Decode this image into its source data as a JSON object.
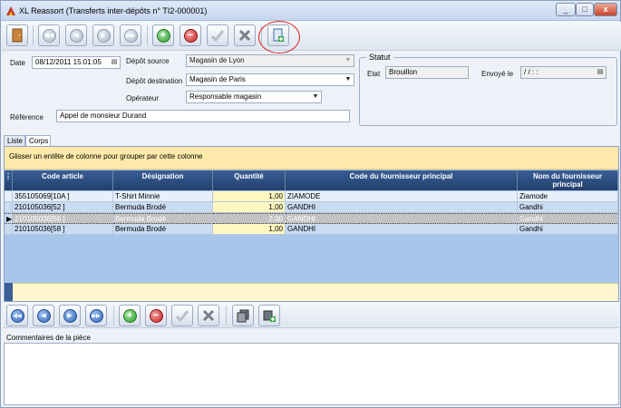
{
  "window": {
    "title": "XL Reassort (Transferts inter-dépôts n° TI2-000001)",
    "controls": {
      "minimize": "_",
      "maximize": "□",
      "close": "x"
    }
  },
  "toolbar": {
    "buttons": [
      {
        "name": "close-document-button",
        "icon": "door-exit-icon"
      },
      {
        "name": "first-record-button",
        "icon": "double-left-icon"
      },
      {
        "name": "previous-record-button",
        "icon": "left-icon"
      },
      {
        "name": "next-record-button",
        "icon": "right-icon"
      },
      {
        "name": "last-record-button",
        "icon": "double-right-icon"
      },
      {
        "name": "add-button",
        "icon": "plus-icon"
      },
      {
        "name": "delete-button",
        "icon": "minus-icon"
      },
      {
        "name": "validate-button",
        "icon": "check-icon"
      },
      {
        "name": "cancel-button",
        "icon": "x-icon"
      },
      {
        "name": "export-button",
        "icon": "document-arrow-icon"
      }
    ]
  },
  "form": {
    "date_label": "Date",
    "date_value": "08/12/2011 15:01:05",
    "depot_source_label": "Dépôt source",
    "depot_source_value": "Magasin de Lyon",
    "depot_dest_label": "Dépôt destination",
    "depot_dest_value": "Magasin de Paris",
    "operateur_label": "Opérateur",
    "operateur_value": "Responsable magasin",
    "reference_label": "Référence",
    "reference_value": "Appel de monsieur Durand"
  },
  "statut": {
    "title": "Statut",
    "etat_label": "Etat",
    "etat_value": "Brouillon",
    "envoye_label": "Envoyé le",
    "envoye_value": "/ /     : :"
  },
  "tabs": [
    {
      "label": "Liste",
      "selected": false
    },
    {
      "label": "Corps",
      "selected": true
    }
  ],
  "grid": {
    "group_hint": "Glisser un entête de colonne pour grouper par cette colonne",
    "columns": [
      "Code article",
      "Désignation",
      "Quantité",
      "Code du fournisseur principal",
      "Nom du fournisseur principal"
    ],
    "rows": [
      {
        "code": "355105069[10A      ]",
        "designation": "T-Shirt Minnie",
        "quantite": "1,00",
        "code_fournisseur": "ZIAMODE",
        "nom_fournisseur": "Ziamode"
      },
      {
        "code": "210105036[52       ]",
        "designation": "Bermuda Brodé",
        "quantite": "1,00",
        "code_fournisseur": "GANDHI",
        "nom_fournisseur": "Gandhi"
      },
      {
        "code": "210105036[56       ]",
        "designation": "Bermuda Brodé",
        "quantite": "2,00",
        "code_fournisseur": "GANDHI",
        "nom_fournisseur": "Gandhi"
      },
      {
        "code": "210105036[58       ]",
        "designation": "Bermuda Brodé",
        "quantite": "1,00",
        "code_fournisseur": "GANDHI",
        "nom_fournisseur": "Gandhi"
      }
    ]
  },
  "comments": {
    "label": "Commentaires de la pièce",
    "value": ""
  },
  "colors": {
    "header_blue": "#2c4a7c",
    "group_banner": "#fdeaaa",
    "grid_bg": "#a8c5ea",
    "highlight_ring": "#d8261f"
  }
}
